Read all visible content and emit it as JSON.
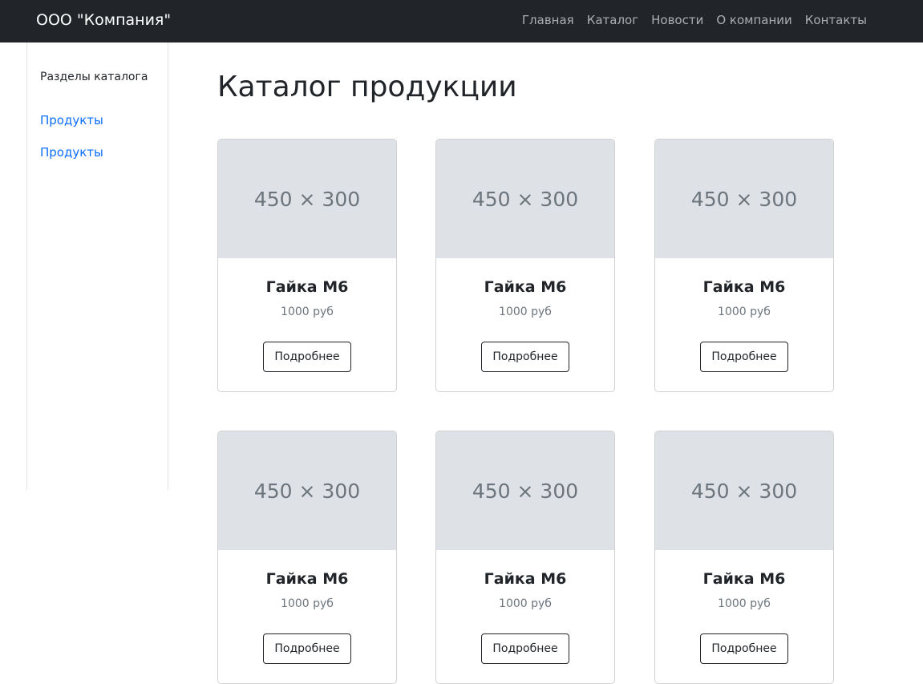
{
  "navbar": {
    "brand": "ООО \"Компания\"",
    "links": [
      "Главная",
      "Каталог",
      "Новости",
      "О компании",
      "Контакты"
    ]
  },
  "sidebar": {
    "title": "Разделы каталога",
    "links": [
      "Продукты",
      "Продукты"
    ]
  },
  "main": {
    "title": "Каталог продукции",
    "products": [
      {
        "image_placeholder": "450 × 300",
        "title": "Гайка М6",
        "price": "1000 руб",
        "button": "Подробнее"
      },
      {
        "image_placeholder": "450 × 300",
        "title": "Гайка М6",
        "price": "1000 руб",
        "button": "Подробнее"
      },
      {
        "image_placeholder": "450 × 300",
        "title": "Гайка М6",
        "price": "1000 руб",
        "button": "Подробнее"
      },
      {
        "image_placeholder": "450 × 300",
        "title": "Гайка М6",
        "price": "1000 руб",
        "button": "Подробнее"
      },
      {
        "image_placeholder": "450 × 300",
        "title": "Гайка М6",
        "price": "1000 руб",
        "button": "Подробнее"
      },
      {
        "image_placeholder": "450 × 300",
        "title": "Гайка М6",
        "price": "1000 руб",
        "button": "Подробнее"
      }
    ]
  },
  "colors": {
    "navbar_bg": "#212529",
    "link": "#0d6efd",
    "placeholder_bg": "#dee2e6"
  }
}
